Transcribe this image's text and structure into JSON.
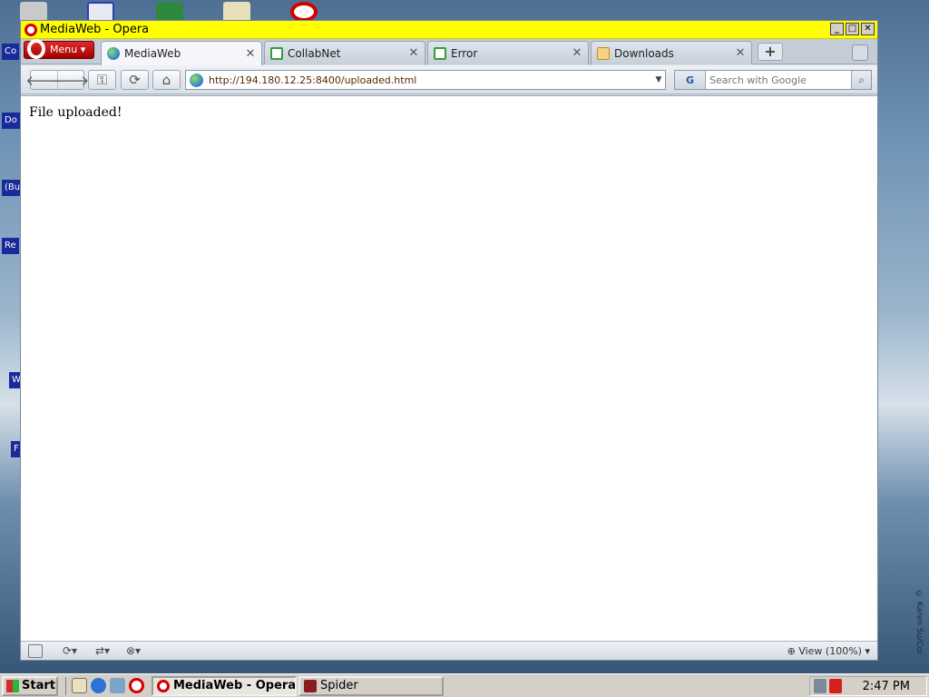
{
  "window": {
    "title": "MediaWeb - Opera",
    "minimize": "_",
    "maximize": "□",
    "close": "✕"
  },
  "desktop": {
    "labels": [
      "Co",
      "Do",
      "(Bu",
      "Re",
      "W",
      "F"
    ],
    "credit": "© Karen Su/Corbis"
  },
  "menu": {
    "label": "Menu"
  },
  "tabs": [
    {
      "label": "MediaWeb",
      "close": "✕",
      "icon": "globe-icon",
      "color": "#3b8e2a"
    },
    {
      "label": "CollabNet",
      "close": "✕",
      "icon": "page-icon",
      "color": "#3a9a3a"
    },
    {
      "label": "Error",
      "close": "✕",
      "icon": "page-icon",
      "color": "#3a9a3a"
    },
    {
      "label": "Downloads",
      "close": "✕",
      "icon": "download-icon",
      "color": "#c98a1a"
    }
  ],
  "toolbar": {
    "back": "🡐",
    "forward": "🡒",
    "wand": "⚿",
    "reload": "⟳",
    "home": "⌂"
  },
  "address": {
    "url": "http://194.180.12.25:8400/uploaded.html",
    "dropdown": "▼"
  },
  "search": {
    "engine": "G",
    "placeholder": "Search with Google",
    "go": "⌕"
  },
  "page": {
    "text": "File uploaded!"
  },
  "statusbar": {
    "zoom": "View (100%)",
    "sync": "⟳▾",
    "share": "⇄▾",
    "widgets": "⊗▾",
    "zoom_icon": "⊕",
    "zoom_dd": "▾"
  },
  "taskbar": {
    "start": "Start",
    "tasks": [
      {
        "label": "MediaWeb - Opera",
        "active": true,
        "color": "#d40000"
      },
      {
        "label": "Spider",
        "active": false,
        "color": "#8a1d1d"
      }
    ],
    "clock": "2:47 PM"
  },
  "colors": {
    "titlebar": "#ffff00",
    "menu": "#c41010",
    "taskbar": "#d4d0c8"
  }
}
